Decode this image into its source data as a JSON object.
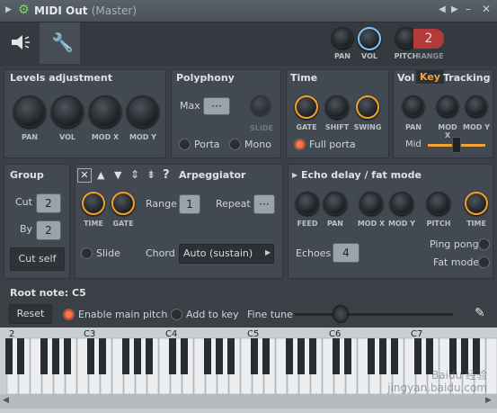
{
  "title": {
    "name": "MIDI Out",
    "context": "(Master)"
  },
  "top_knobs": {
    "pan": "PAN",
    "vol": "VOL",
    "pitch": "PITCH",
    "range": "RANGE",
    "range_value": "2"
  },
  "levels": {
    "title": "Levels adjustment",
    "knobs": [
      "PAN",
      "VOL",
      "MOD X",
      "MOD Y"
    ]
  },
  "polyphony": {
    "title": "Polyphony",
    "max": "Max",
    "max_value": "···",
    "slide": "SLIDE",
    "porta": "Porta",
    "mono": "Mono"
  },
  "time": {
    "title": "Time",
    "knobs": [
      "GATE",
      "SHIFT",
      "SWING"
    ],
    "full_porta": "Full porta"
  },
  "vkt": {
    "vol": "Vol",
    "key": "Key",
    "tracking": "Tracking",
    "knobs": [
      "PAN",
      "MOD X",
      "MOD Y"
    ],
    "mid": "Mid"
  },
  "group": {
    "title": "Group",
    "cut": "Cut",
    "cut_value": "2",
    "by": "By",
    "by_value": "2",
    "cut_self": "Cut self"
  },
  "arp": {
    "title": "Arpeggiator",
    "time": "TIME",
    "gate": "GATE",
    "range": "Range",
    "range_value": "1",
    "repeat": "Repeat",
    "repeat_value": "···",
    "slide": "Slide",
    "chord": "Chord",
    "chord_value": "Auto (sustain)",
    "icons": [
      "✕",
      "▲",
      "▼",
      "⇕",
      "⇟",
      "?"
    ]
  },
  "echo": {
    "title": "Echo delay / fat mode",
    "knobs": [
      "FEED",
      "PAN",
      "MOD X",
      "MOD Y",
      "PITCH",
      "TIME"
    ],
    "echoes": "Echoes",
    "echoes_value": "4",
    "ping_pong": "Ping pong",
    "fat_mode": "Fat mode"
  },
  "root": {
    "title": "Root note: C5",
    "reset": "Reset",
    "enable_main_pitch": "Enable main pitch",
    "add_to_key": "Add to key",
    "fine_tune": "Fine tune"
  },
  "keyboard": {
    "labels": [
      "2",
      "C3",
      "C4",
      "C5",
      "C6",
      "C7"
    ],
    "highlight": "C5"
  },
  "watermark": "Baidu 经验 jingyan.baidu.com"
}
